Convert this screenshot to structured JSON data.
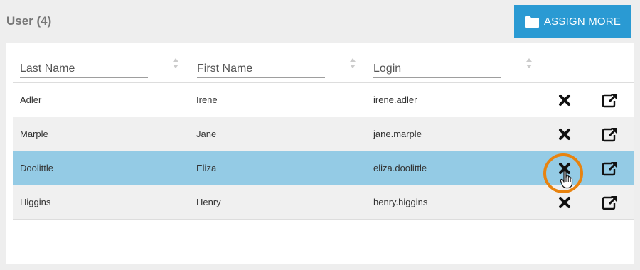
{
  "header": {
    "title": "User (4)"
  },
  "toolbar": {
    "assign_label": "ASSIGN MORE",
    "assign_icon": "folder-icon"
  },
  "filters": [
    {
      "placeholder": "Last Name"
    },
    {
      "placeholder": "First Name"
    },
    {
      "placeholder": "Login"
    }
  ],
  "rows": [
    {
      "last": "Adler",
      "first": "Irene",
      "login": "irene.adler"
    },
    {
      "last": "Marple",
      "first": "Jane",
      "login": "jane.marple"
    },
    {
      "last": "Doolittle",
      "first": "Eliza",
      "login": "eliza.doolittle"
    },
    {
      "last": "Higgins",
      "first": "Henry",
      "login": "henry.higgins"
    }
  ],
  "row_actions": {
    "remove_icon": "close-icon",
    "open_icon": "external-link-icon"
  },
  "colors": {
    "accent": "#2a9ad3",
    "selected_row": "#94cbe5",
    "alt_row": "#f0f0f0",
    "highlight": "#e8830f"
  }
}
